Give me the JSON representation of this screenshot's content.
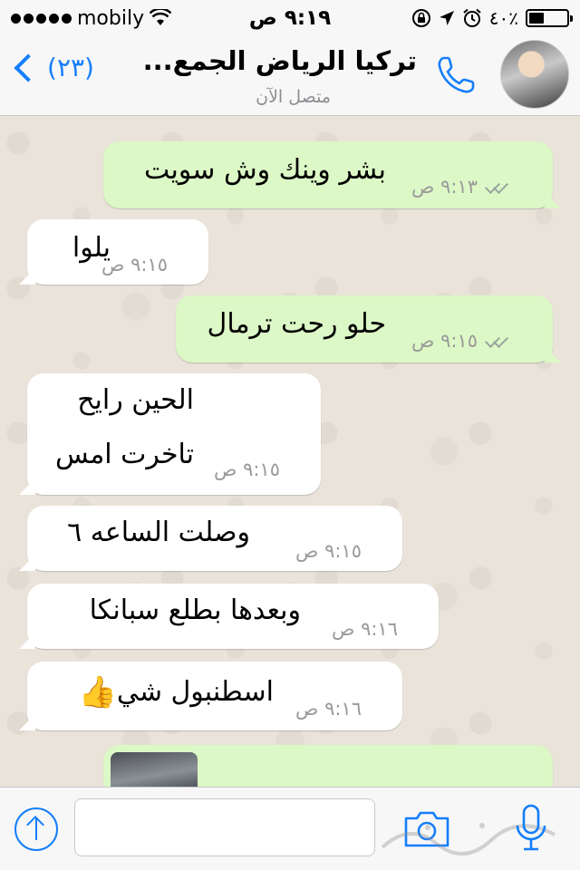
{
  "status_bar": {
    "carrier": "mobily",
    "time": "٩:١٩ ص",
    "battery_percent": "٪٤٠",
    "battery_level": 0.4
  },
  "nav": {
    "back_count": "(٢٣)",
    "title": "تركيا الرياض الجمع...",
    "subtitle": "متصل الآن"
  },
  "messages": [
    {
      "direction": "out",
      "lines": [
        "بشر وينك وش سويت"
      ],
      "time": "٩:١٣ ص",
      "ticks": true
    },
    {
      "direction": "in",
      "lines": [
        "يلوا"
      ],
      "time": "٩:١٥ ص"
    },
    {
      "direction": "out",
      "lines": [
        "حلو رحت ترمال"
      ],
      "time": "٩:١٥ ص",
      "ticks": true
    },
    {
      "direction": "in",
      "lines": [
        "الحين رايح",
        "تاخرت امس"
      ],
      "time": "٩:١٥ ص"
    },
    {
      "direction": "in",
      "lines": [
        "وصلت الساعه ٦"
      ],
      "time": "٩:١٥ ص"
    },
    {
      "direction": "in",
      "lines": [
        "وبعدها بطلع سبانكا"
      ],
      "time": "٩:١٦ ص"
    },
    {
      "direction": "in",
      "lines": [
        "اسطنبول شي"
      ],
      "time": "٩:١٦ ص",
      "emoji": "👍"
    }
  ],
  "input": {
    "value": "",
    "placeholder": ""
  },
  "icons": {
    "back": "chevron-left-icon",
    "call": "phone-icon",
    "upload": "upload-arrow-icon",
    "camera": "camera-icon",
    "mic": "microphone-icon"
  },
  "colors": {
    "accent": "#157efb",
    "outgoing_bubble": "#dcf8c6",
    "incoming_bubble": "#ffffff",
    "chat_background": "#e9e3da"
  }
}
